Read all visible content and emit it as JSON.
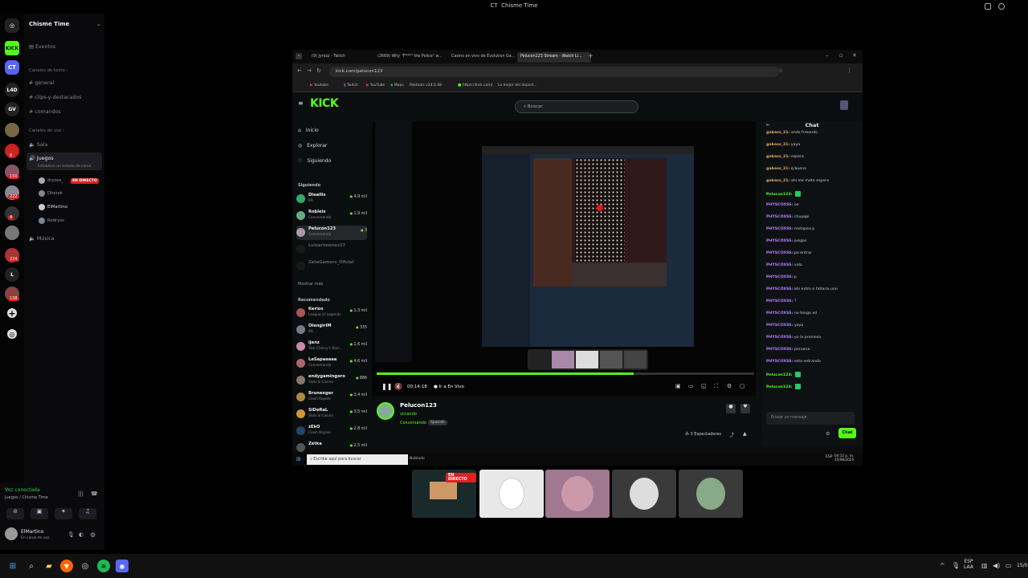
{
  "window": {
    "title": "Chisme Time",
    "server_initials": "CT"
  },
  "rail": {
    "servers": [
      {
        "label": "KICK",
        "color": "#53fc18",
        "text": "#000"
      },
      {
        "label": "CT",
        "color": "#5865f2",
        "text": "#fff"
      },
      {
        "label": "L4D",
        "color": "#222",
        "text": "#fff"
      },
      {
        "label": "GV",
        "color": "#222",
        "text": "#fff"
      },
      {
        "label": "L",
        "color": "#222",
        "text": "#fff"
      }
    ],
    "badges": [
      "8",
      "150",
      "222",
      "4",
      "224",
      "138"
    ]
  },
  "sidebar": {
    "server_name": "Chisme Time",
    "events": "Eventos",
    "text_category": "Canales de texto",
    "text_channels": [
      "general",
      "clips-y-destacados",
      "comandos"
    ],
    "voice_category": "Canales de voz",
    "voice_channels": {
      "sala": "Sala",
      "juegos": "Juegos",
      "status": "Establece un estado de canal",
      "musica": "Música"
    },
    "voice_users": [
      {
        "name": "dryoss_",
        "live": true
      },
      {
        "name": "Dherek",
        "live": false
      },
      {
        "name": "ElMartino",
        "live": false
      },
      {
        "name": "Rodryss",
        "live": false
      }
    ],
    "live_label": "EN DIRECTO"
  },
  "voice_panel": {
    "status": "Voz conectada",
    "location": "Juegos / Chisme Time",
    "username": "ElMartino",
    "substatus": "En canal de voz"
  },
  "browser": {
    "tabs": [
      "(9) Jyrozz - Twitch",
      "(2669) Why \"F***\" the Police\" w...",
      "Casino en vivo de Evolution Ga...",
      "Pelucon123 Stream - Watch Li..."
    ],
    "url": "kick.com/pelucon123",
    "bookmarks": [
      "Youtube",
      "Twitch",
      "YouTube",
      "Maps",
      "Paktools v24.0.48",
      "https://kick.com/",
      "Lo mejor del deport..."
    ]
  },
  "kick": {
    "logo": "KICK",
    "search_placeholder": "Buscar",
    "nav": [
      "Inicio",
      "Explorar",
      "Siguiendo"
    ],
    "following_title": "Siguiendo",
    "following": [
      {
        "name": "Dleallis",
        "sub": "IRL",
        "viewers": "4,9 mil",
        "color": "#3a6"
      },
      {
        "name": "Robleis",
        "sub": "Conversando",
        "viewers": "1,9 mil",
        "color": "#6a8"
      },
      {
        "name": "Pelucon123",
        "sub": "Conversando",
        "viewers": "3",
        "color": "#a9a"
      },
      {
        "name": "Luisarimenez27",
        "sub": "",
        "viewers": "",
        "color": "#333"
      },
      {
        "name": "ZetaGamers_Oficial",
        "sub": "",
        "viewers": "",
        "color": "#333"
      }
    ],
    "show_more": "Mostrar más",
    "recommended_title": "Recomendado",
    "recommended": [
      {
        "name": "Kerios",
        "sub": "League of Legends",
        "viewers": "1,3 mil",
        "color": "#a55"
      },
      {
        "name": "OlengirIM",
        "sub": "IRL",
        "viewers": "335",
        "color": "#778"
      },
      {
        "name": "ijenz",
        "sub": "Tom Clancy's Rain...",
        "viewers": "1,6 mil",
        "color": "#c8a"
      },
      {
        "name": "LaSapaaaaa",
        "sub": "Conversando",
        "viewers": "4,6 mil",
        "color": "#a66"
      },
      {
        "name": "endygamingoro",
        "sub": "Slots & Casino",
        "viewers": "886",
        "color": "#876"
      },
      {
        "name": "Brunenger",
        "sub": "Clash Royale",
        "viewers": "3,4 mil",
        "color": "#a84"
      },
      {
        "name": "SiDeRaL",
        "sub": "Slots & Casino",
        "viewers": "3,5 mil",
        "color": "#c93"
      },
      {
        "name": "zEkO",
        "sub": "Clash Royale",
        "viewers": "2,8 mil",
        "color": "#246"
      },
      {
        "name": "Zetka",
        "sub": "",
        "viewers": "2,5 mil",
        "color": "#555"
      }
    ],
    "player": {
      "time": "00:14:18",
      "live_btn": "Ir a En Vivo",
      "progress": 0.68
    },
    "streamer": {
      "name": "Pelucon123",
      "status": "viciando",
      "category": "Conversando",
      "language": "Spanish",
      "viewers": "3 Espectadores"
    },
    "chat": {
      "title": "Chat",
      "input_placeholder": "Enviar un mensaje",
      "send": "Chat",
      "messages": [
        {
          "user": "gabass_21:",
          "text": "ando frreendo",
          "color": "#e0b060"
        },
        {
          "user": "gabass_21:",
          "text": "yaya",
          "color": "#e0b060"
        },
        {
          "user": "gabass_21:",
          "text": "espera",
          "color": "#e0b060"
        },
        {
          "user": "gabass_21:",
          "text": "q bueno",
          "color": "#e0b060"
        },
        {
          "user": "gabass_21:",
          "text": "ahi me meto espera",
          "color": "#e0b060"
        },
        {
          "user": "Pelucon123:",
          "text": "",
          "color": "#53fc18"
        },
        {
          "user": "PHYSCOXSS:",
          "text": "oe",
          "color": "#b080ff"
        },
        {
          "user": "PHYSCOXSS:",
          "text": "chupapi",
          "color": "#b080ff"
        },
        {
          "user": "PHYSCOXSS:",
          "text": "metapea p",
          "color": "#b080ff"
        },
        {
          "user": "PHYSCOXSS:",
          "text": "juegas",
          "color": "#b080ff"
        },
        {
          "user": "PHYSCOXSS:",
          "text": "pa entrar",
          "color": "#b080ff"
        },
        {
          "user": "PHYSCOXSS:",
          "text": "valo",
          "color": "#b080ff"
        },
        {
          "user": "PHYSCOXSS:",
          "text": "p",
          "color": "#b080ff"
        },
        {
          "user": "PHYSCOXSS:",
          "text": "ahi entro o faltaria uno",
          "color": "#b080ff"
        },
        {
          "user": "PHYSCOXSS:",
          "text": "?",
          "color": "#b080ff"
        },
        {
          "user": "PHYSCOXSS:",
          "text": "no tengo xd",
          "color": "#b080ff"
        },
        {
          "user": "PHYSCOXSS:",
          "text": "yaya",
          "color": "#b080ff"
        },
        {
          "user": "PHYSCOXSS:",
          "text": "yo la promesa",
          "color": "#b080ff"
        },
        {
          "user": "PHYSCOXSS:",
          "text": "peruana",
          "color": "#b080ff"
        },
        {
          "user": "PHYSCOXSS:",
          "text": "esta entrando",
          "color": "#b080ff"
        },
        {
          "user": "Pelucon123:",
          "text": "",
          "color": "#53fc18"
        },
        {
          "user": "Pelucon123:",
          "text": "",
          "color": "#53fc18"
        }
      ]
    },
    "inner_taskbar": {
      "search": "Escribe aquí para buscar",
      "weather": "Nublado",
      "lang": "ESP",
      "time": "04:12 p. m.",
      "date": "15/08/2025"
    }
  },
  "participants": {
    "live_label": "EN DIRECTO"
  },
  "taskbar": {
    "lang": "ESP",
    "sublang": "LAA",
    "date": "15/0"
  }
}
